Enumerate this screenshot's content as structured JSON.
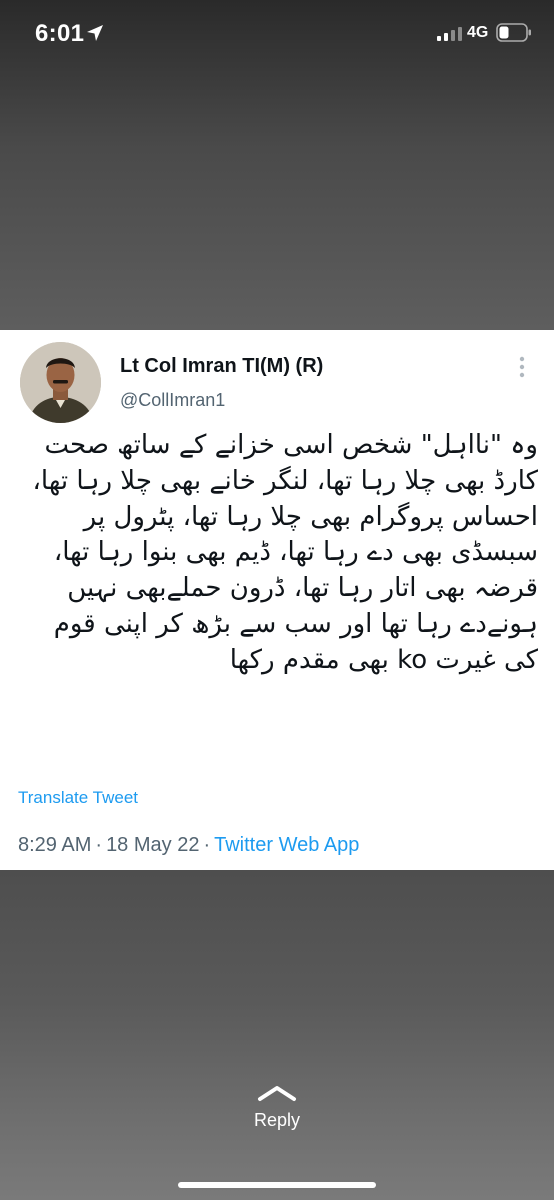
{
  "status_bar": {
    "time": "6:01",
    "network": "4G",
    "location_icon": "location-arrow-icon",
    "signal_icon": "cellular-signal-icon",
    "battery_icon": "battery-icon"
  },
  "tweet": {
    "display_name": "Lt Col Imran TI(M) (R)",
    "handle": "@CollImran1",
    "more_icon": "more-options-icon",
    "text": "وہ \"نااہل\" شخص اسی خزانے کے ساتھ صحت کارڈ بھی چلا رہا تھا، لنگر خانے بھی چلا رہا تھا، احساس پروگرام بھی چلا رہا تھا، پٹرول پر سبسڈی بھی دے رہا تھا، ڈیم بھی بنوا رہا تھا،  قرضہ بھی اتار رہا تھا، ڈرون حملےبھی نہیں ہونےدے رہا تھا اور سب سے بڑھ کر اپنی قوم کی غیرت ko بھی مقدم رکھا",
    "translate_label": "Translate Tweet",
    "time": "8:29 AM",
    "date": "18 May 22",
    "separator": "·",
    "source": "Twitter Web App"
  },
  "reply": {
    "label": "Reply",
    "icon": "chevron-up-icon"
  },
  "colors": {
    "accent": "#1d9bf0",
    "text_primary": "#0f1419",
    "text_secondary": "#536471"
  }
}
